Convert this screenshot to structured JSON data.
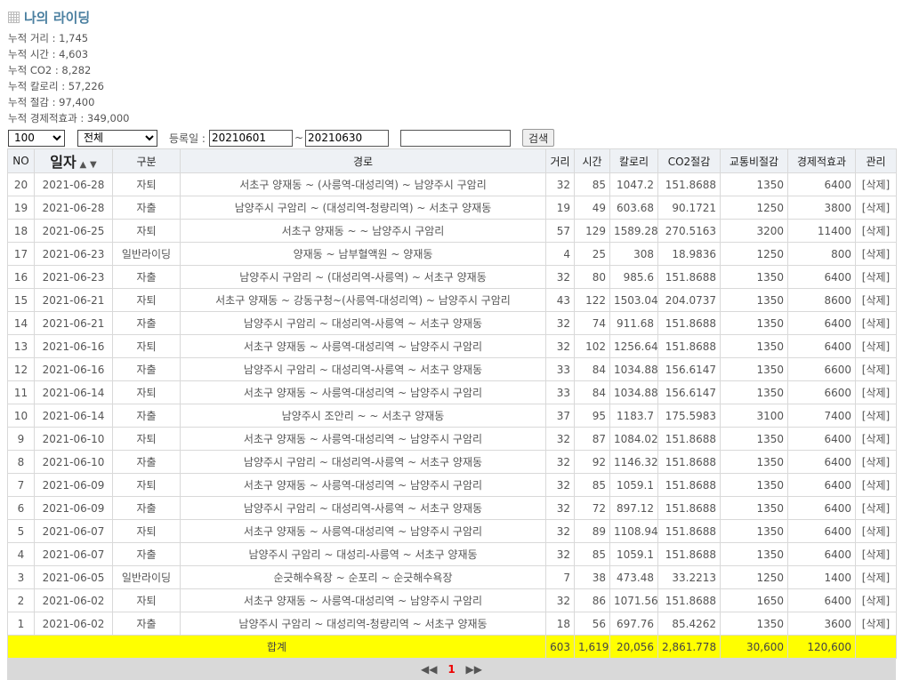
{
  "title": "나의 라이딩",
  "stats": [
    "누적 거리 : 1,745",
    "누적 시간 : 4,603",
    "누적 CO2 : 8,282",
    "누적 칼로리 : 57,226",
    "누적 절감 : 97,400",
    "누적 경제적효과 : 349,000"
  ],
  "filters": {
    "page_size": "100",
    "category": "전체",
    "date_label": "등록일 :",
    "date_from": "20210601",
    "date_sep": "~",
    "date_to": "20210630",
    "keyword": "",
    "search_label": "검색"
  },
  "table": {
    "headers": [
      "NO",
      "일자",
      "구분",
      "경로",
      "거리",
      "시간",
      "칼로리",
      "CO2절감",
      "교통비절감",
      "경제적효과",
      "관리"
    ],
    "sort_up": "▲",
    "sort_down": "▼",
    "rows": [
      [
        "20",
        "2021-06-28",
        "자퇴",
        "서초구 양재동 ~ (사릉역-대성리역) ~ 남양주시 구암리",
        "32",
        "85",
        "1047.2",
        "151.8688",
        "1350",
        "6400",
        "[삭제]"
      ],
      [
        "19",
        "2021-06-28",
        "자출",
        "남양주시 구암리 ~ (대성리역-청량리역) ~ 서초구 양재동",
        "19",
        "49",
        "603.68",
        "90.1721",
        "1250",
        "3800",
        "[삭제]"
      ],
      [
        "18",
        "2021-06-25",
        "자퇴",
        "서초구 양재동 ~ ~ 남양주시 구암리",
        "57",
        "129",
        "1589.28",
        "270.5163",
        "3200",
        "11400",
        "[삭제]"
      ],
      [
        "17",
        "2021-06-23",
        "일반라이딩",
        "양재동 ~ 남부혈액원 ~ 양재동",
        "4",
        "25",
        "308",
        "18.9836",
        "1250",
        "800",
        "[삭제]"
      ],
      [
        "16",
        "2021-06-23",
        "자출",
        "남양주시 구암리 ~ (대성리역-사릉역) ~ 서초구 양재동",
        "32",
        "80",
        "985.6",
        "151.8688",
        "1350",
        "6400",
        "[삭제]"
      ],
      [
        "15",
        "2021-06-21",
        "자퇴",
        "서초구 양재동 ~ 강동구청~(사릉역-대성리역) ~ 남양주시 구암리",
        "43",
        "122",
        "1503.04",
        "204.0737",
        "1350",
        "8600",
        "[삭제]"
      ],
      [
        "14",
        "2021-06-21",
        "자출",
        "남양주시 구암리 ~ 대성리역-사릉역 ~ 서초구 양재동",
        "32",
        "74",
        "911.68",
        "151.8688",
        "1350",
        "6400",
        "[삭제]"
      ],
      [
        "13",
        "2021-06-16",
        "자퇴",
        "서초구 양재동 ~ 사릉역-대성리역 ~ 남양주시 구암리",
        "32",
        "102",
        "1256.64",
        "151.8688",
        "1350",
        "6400",
        "[삭제]"
      ],
      [
        "12",
        "2021-06-16",
        "자출",
        "남양주시 구암리 ~ 대성리역-사릉역 ~ 서초구 양재동",
        "33",
        "84",
        "1034.88",
        "156.6147",
        "1350",
        "6600",
        "[삭제]"
      ],
      [
        "11",
        "2021-06-14",
        "자퇴",
        "서초구 양재동 ~ 사릉역-대성리역 ~ 남양주시 구암리",
        "33",
        "84",
        "1034.88",
        "156.6147",
        "1350",
        "6600",
        "[삭제]"
      ],
      [
        "10",
        "2021-06-14",
        "자출",
        "남양주시 조안리 ~ ~ 서초구 양재동",
        "37",
        "95",
        "1183.7",
        "175.5983",
        "3100",
        "7400",
        "[삭제]"
      ],
      [
        "9",
        "2021-06-10",
        "자퇴",
        "서초구 양재동 ~ 사릉역-대성리역 ~ 남양주시 구암리",
        "32",
        "87",
        "1084.02",
        "151.8688",
        "1350",
        "6400",
        "[삭제]"
      ],
      [
        "8",
        "2021-06-10",
        "자출",
        "남양주시 구암리 ~ 대성리역-사릉역 ~ 서초구 양재동",
        "32",
        "92",
        "1146.32",
        "151.8688",
        "1350",
        "6400",
        "[삭제]"
      ],
      [
        "7",
        "2021-06-09",
        "자퇴",
        "서초구 양재동 ~ 사릉역-대성리역 ~ 남양주시 구암리",
        "32",
        "85",
        "1059.1",
        "151.8688",
        "1350",
        "6400",
        "[삭제]"
      ],
      [
        "6",
        "2021-06-09",
        "자출",
        "남양주시 구암리 ~ 대성리역-사릉역 ~ 서초구 양재동",
        "32",
        "72",
        "897.12",
        "151.8688",
        "1350",
        "6400",
        "[삭제]"
      ],
      [
        "5",
        "2021-06-07",
        "자퇴",
        "서초구 양재동 ~ 사릉역-대성리역 ~ 남양주시 구암리",
        "32",
        "89",
        "1108.94",
        "151.8688",
        "1350",
        "6400",
        "[삭제]"
      ],
      [
        "4",
        "2021-06-07",
        "자출",
        "남양주시 구암리 ~ 대성리-사릉역 ~ 서초구 양재동",
        "32",
        "85",
        "1059.1",
        "151.8688",
        "1350",
        "6400",
        "[삭제]"
      ],
      [
        "3",
        "2021-06-05",
        "일반라이딩",
        "순긋해수욕장 ~ 순포리 ~ 순긋해수욕장",
        "7",
        "38",
        "473.48",
        "33.2213",
        "1250",
        "1400",
        "[삭제]"
      ],
      [
        "2",
        "2021-06-02",
        "자퇴",
        "서초구 양재동 ~ 사릉역-대성리역 ~ 남양주시 구암리",
        "32",
        "86",
        "1071.56",
        "151.8688",
        "1650",
        "6400",
        "[삭제]"
      ],
      [
        "1",
        "2021-06-02",
        "자출",
        "남양주시 구암리 ~ 대성리역-청량리역 ~ 서초구 양재동",
        "18",
        "56",
        "697.76",
        "85.4262",
        "1350",
        "3600",
        "[삭제]"
      ]
    ],
    "total": {
      "label": "합계",
      "distance": "603",
      "time": "1,619",
      "calorie": "20,056",
      "co2": "2,861.778",
      "transport": "30,600",
      "economic": "120,600"
    }
  },
  "pager": {
    "prev": "◀◀",
    "current": "1",
    "next": "▶▶"
  }
}
